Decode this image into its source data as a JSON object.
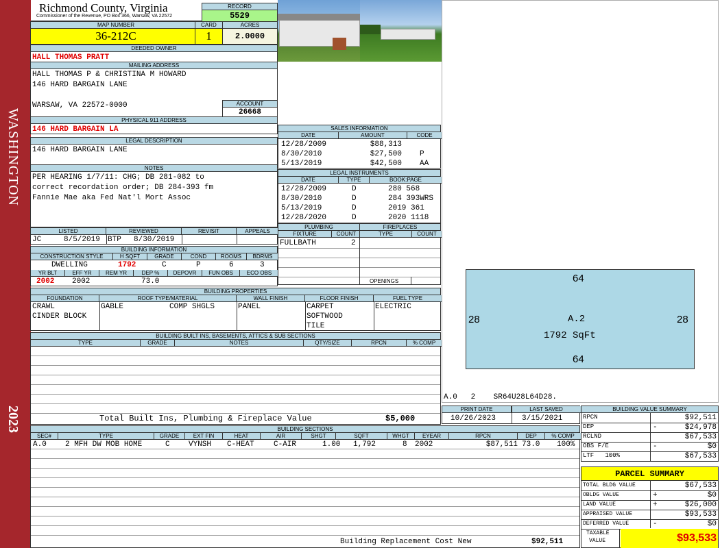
{
  "sidebar": {
    "district": "WASHINGTON",
    "year": "2023"
  },
  "header": {
    "county": "Richmond County, Virginia",
    "commissioner": "Commissioner of the Revenue, PO Box 366, Warsaw, VA 22572",
    "record_label": "RECORD",
    "record": "5529",
    "map_number_label": "MAP NUMBER",
    "map_number": "36-212C",
    "card_label": "CARD",
    "card": "1",
    "acres_label": "ACRES",
    "acres": "2.0000"
  },
  "owner": {
    "label": "DEEDED OWNER",
    "name": "HALL THOMAS PRATT"
  },
  "mailing": {
    "label": "MAILING ADDRESS",
    "line1": "HALL THOMAS P & CHRISTINA M HOWARD",
    "line2": "146 HARD BARGAIN LANE",
    "line3": "WARSAW, VA 22572-0000",
    "account_label": "ACCOUNT",
    "account": "26668"
  },
  "physical": {
    "label": "PHYSICAL 911 ADDRESS",
    "address": "146 HARD BARGAIN LA"
  },
  "legal": {
    "label": "LEGAL DESCRIPTION",
    "text": "146 HARD BARGAIN LANE"
  },
  "notes": {
    "label": "NOTES",
    "line1": "PER HEARING 1/7/11: CHG; DB 281-082 to",
    "line2": "correct recordation order; DB 284-393 fm",
    "line3": "Fannie Mae aka Fed Nat'l Mort Assoc"
  },
  "listing": {
    "listed_label": "LISTED",
    "reviewed_label": "REVIEWED",
    "revisit_label": "REVISIT",
    "appeals_label": "APPEALS",
    "listed_by": "JC",
    "listed_date": "8/5/2019",
    "reviewed_by": "BTP",
    "reviewed_date": "8/30/2019"
  },
  "sales": {
    "label": "SALES INFORMATION",
    "cols": [
      "DATE",
      "AMOUNT",
      "CODE"
    ],
    "rows": [
      [
        "12/28/2009",
        "$88,313",
        ""
      ],
      [
        "8/30/2010",
        "$27,500",
        "P"
      ],
      [
        "5/13/2019",
        "$42,500",
        "AA"
      ]
    ]
  },
  "instruments": {
    "label": "LEGAL INSTRUMENTS",
    "cols": [
      "DATE",
      "TYPE",
      "BOOK:PAGE"
    ],
    "rows": [
      [
        "12/28/2009",
        "D",
        "280 568"
      ],
      [
        "8/30/2010",
        "D",
        "284 393WRS"
      ],
      [
        "5/13/2019",
        "D",
        "2019 361"
      ],
      [
        "12/28/2020",
        "D",
        "2020 1118"
      ]
    ]
  },
  "plumbing": {
    "label": "PLUMBING",
    "cols": [
      "FIXTURE",
      "COUNT"
    ],
    "fixture": "FULLBATH",
    "count": "2"
  },
  "fireplaces": {
    "label": "FIREPLACES",
    "cols": [
      "TYPE",
      "COUNT"
    ],
    "openings_label": "OPENINGS"
  },
  "building_info": {
    "label": "BUILDING INFORMATION",
    "cols": [
      "CONSTRUCTION STYLE",
      "H SQFT",
      "GRADE",
      "COND",
      "ROOMS",
      "BDRMS"
    ],
    "style": "DWELLING",
    "hsqft": "1792",
    "grade": "C",
    "cond": "P",
    "rooms": "6",
    "bdrms": "3",
    "cols2": [
      "YR BLT",
      "EFF YR",
      "REM YR",
      "DEP %",
      "DEPOVR",
      "FUN OBS",
      "ECO OBS"
    ],
    "yr_blt": "2002",
    "eff_yr": "2002",
    "dep": "73.0"
  },
  "properties": {
    "label": "BUILDING PROPERTIES",
    "cols": [
      "FOUNDATION",
      "ROOF TYPE/MATERIAL",
      "WALL FINISH",
      "FLOOR FINISH",
      "FUEL TYPE"
    ],
    "foundation1": "CRAWL",
    "foundation2": "CINDER BLOCK",
    "roof_type": "GABLE",
    "roof_material": "COMP SHGLS",
    "wall": "PANEL",
    "floor1": "CARPET",
    "floor2": "SOFTWOOD",
    "floor3": "TILE",
    "fuel": "ELECTRIC"
  },
  "builtins": {
    "label": "BUILDING BUILT INS, BASEMENTS, ATTICS & SUB SECTIONS",
    "cols": [
      "TYPE",
      "GRADE",
      "NOTES",
      "QTY/SIZE",
      "RPCN",
      "% COMP"
    ],
    "total_label": "Total Built Ins, Plumbing & Fireplace Value",
    "total": "$5,000"
  },
  "sketch": {
    "top": "64",
    "bottom": "64",
    "left": "28",
    "right": "28",
    "label": "A.2",
    "area": "1792 SqFt",
    "caption": "A.0   2    SR64U28L64D28."
  },
  "dates": {
    "print_label": "PRINT DATE",
    "saved_label": "LAST SAVED",
    "print": "10/26/2023",
    "saved": "3/15/2021"
  },
  "sections": {
    "label": "BUILDING SECTIONS",
    "cols": [
      "SEC#",
      "TYPE",
      "GRADE",
      "EXT FIN",
      "HEAT",
      "AIR",
      "SHGT",
      "SQFT",
      "WHGT",
      "EYEAR",
      "RPCN",
      "DEP",
      "% COMP"
    ],
    "row": [
      "A.0",
      "2 MFH DW MOB HOME",
      "C",
      "VYNSH",
      "C-HEAT",
      "C-AIR",
      "1.00",
      "1,792",
      "8",
      "2002",
      "$87,511",
      "73.0",
      "100%"
    ],
    "brcn_label": "Building Replacement Cost New",
    "brcn": "$92,511"
  },
  "value_summary": {
    "label": "BUILDING VALUE SUMMARY",
    "rows": [
      [
        "RPCN",
        "",
        "$92,511"
      ],
      [
        "DEP",
        "-",
        "$24,978"
      ],
      [
        "RCLND",
        "",
        "$67,533"
      ],
      [
        "OBS F/E",
        "-",
        "$0"
      ],
      [
        "LTF   100%",
        "",
        "$67,533"
      ]
    ]
  },
  "parcel": {
    "label": "PARCEL SUMMARY",
    "rows": [
      [
        "TOTAL BLDG VALUE",
        "",
        "$67,533"
      ],
      [
        "OBLDG VALUE",
        "+",
        "$0"
      ],
      [
        "LAND VALUE",
        "+",
        "$26,000"
      ],
      [
        "APPRAISED VALUE",
        "",
        "$93,533"
      ],
      [
        "DEFERRED VALUE",
        "-",
        "$0"
      ]
    ],
    "taxable_label1": "TAXABLE",
    "taxable_label2": "VALUE",
    "taxable": "$93,533"
  },
  "colors": {
    "sidebar": "#a5262c",
    "header_blue": "#b9d8e4",
    "yellow": "#ffff00",
    "green": "#a9f58a",
    "red": "#e00000"
  }
}
